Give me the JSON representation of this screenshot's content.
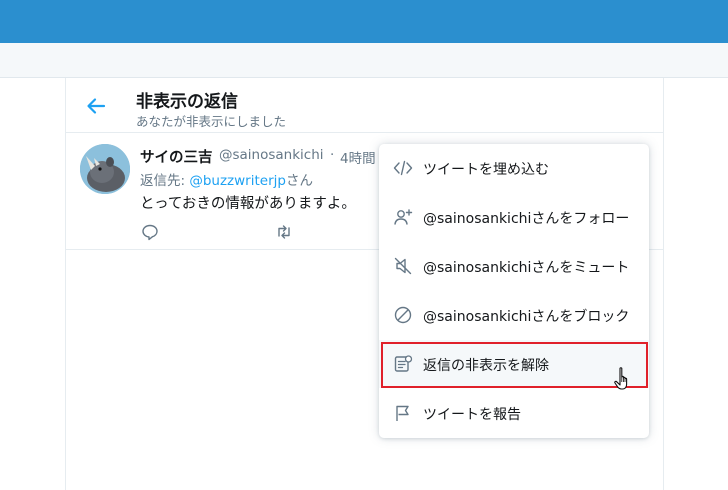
{
  "header": {
    "title": "非表示の返信",
    "subtitle": "あなたが非表示にしました"
  },
  "tweet": {
    "name": "サイの三吉",
    "handle": "@sainosankichi",
    "separator": "·",
    "time": "4時間",
    "reply_prefix": "返信先: ",
    "reply_mention": "@buzzwriterjp",
    "reply_suffix": "さん",
    "text": "とっておきの情報がありますよ。"
  },
  "menu": {
    "items": [
      {
        "label": "ツイートを埋め込む",
        "icon": "code-icon"
      },
      {
        "label": "@sainosankichiさんをフォロー",
        "icon": "follow-icon"
      },
      {
        "label": "@sainosankichiさんをミュート",
        "icon": "mute-icon"
      },
      {
        "label": "@sainosankichiさんをブロック",
        "icon": "block-icon"
      },
      {
        "label": "返信の非表示を解除",
        "icon": "unhide-reply-icon"
      },
      {
        "label": "ツイートを報告",
        "icon": "flag-icon"
      }
    ]
  },
  "colors": {
    "topbar": "#2b8fcf",
    "accent": "#1da1f2",
    "highlight": "#e0202a",
    "secondary_text": "#657786"
  }
}
